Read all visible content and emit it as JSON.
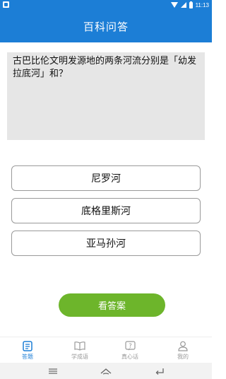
{
  "status_bar": {
    "time": "11:13"
  },
  "header": {
    "title": "百科问答"
  },
  "question": {
    "text": "古巴比伦文明发源地的两条河流分别是「幼发拉底河」和？"
  },
  "options": [
    {
      "label": "尼罗河"
    },
    {
      "label": "底格里斯河"
    },
    {
      "label": "亚马孙河"
    }
  ],
  "answer_button": {
    "label": "看答案"
  },
  "tabs": [
    {
      "label": "答题",
      "active": true
    },
    {
      "label": "学成语",
      "active": false
    },
    {
      "label": "真心话",
      "active": false
    },
    {
      "label": "我的",
      "active": false
    }
  ],
  "colors": {
    "primary": "#1c7ed6",
    "answer_button": "#6db52b"
  }
}
